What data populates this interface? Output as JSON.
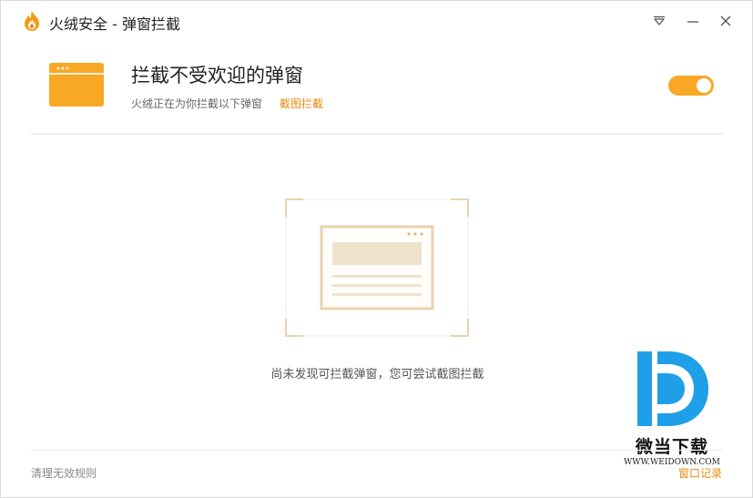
{
  "window": {
    "title": "火绒安全 - 弹窗拦截"
  },
  "titlebar": {
    "buttons": [
      {
        "name": "menu",
        "icon": "dropdown-menu-icon"
      },
      {
        "name": "minimize",
        "icon": "minimize-icon"
      },
      {
        "name": "close",
        "icon": "close-icon"
      }
    ]
  },
  "header": {
    "icon": "browser-window-icon",
    "title": "拦截不受欢迎的弹窗",
    "subtitle": "火绒正在为你拦截以下弹窗",
    "link": "截图拦截",
    "toggle": {
      "on": true,
      "color": "#f9a825"
    }
  },
  "empty_state": {
    "illustration": "empty-popup-illustration",
    "message": "尚未发现可拦截弹窗，您可尝试截图拦截"
  },
  "footer": {
    "left_link": "清理无效规则",
    "right_link": "窗口记录"
  },
  "watermark": {
    "title": "微当下载",
    "url": "WWW.WEIDOWN.COM"
  },
  "colors": {
    "accent": "#f9a825",
    "link": "#e88a0c",
    "illustration": "#e8d3b0",
    "watermark_blue": "#1e9fe8"
  }
}
